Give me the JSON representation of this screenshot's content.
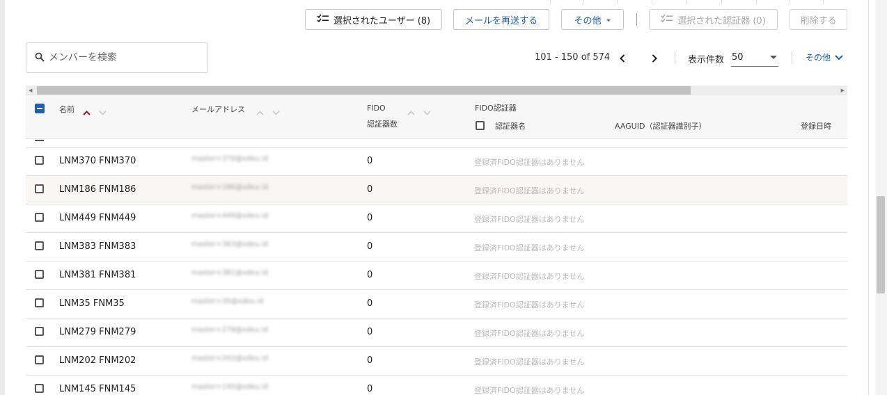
{
  "toolbar": {
    "selected_users_label": "選択されたユーザー (8)",
    "resend_mail_label": "メールを再送する",
    "others_label": "その他",
    "selected_authenticators_label": "選択された認証器 (0)",
    "delete_label": "削除する"
  },
  "search": {
    "placeholder": "メンバーを検索"
  },
  "pager": {
    "range": "101 - 150 of 574",
    "per_page_label": "表示件数",
    "per_page_value": "50",
    "more_label": "その他"
  },
  "table": {
    "columns": {
      "name": "名前",
      "email": "メールアドレス",
      "fido_line1": "FIDO",
      "fido_line2": "認証器数",
      "fido_auth_group": "FIDO認証器",
      "auth_name": "認証器名",
      "aaguid": "AAGUID（認証器識別子）",
      "registered_at": "登録日時"
    },
    "rows": [
      {
        "name": "LNM370 FNM370",
        "email": "master+370@xdeu.id",
        "fido_count": "0",
        "fido_status": "登録済FIDO認証器はありません",
        "highlight": false
      },
      {
        "name": "LNM186 FNM186",
        "email": "master+186@xdeu.id",
        "fido_count": "0",
        "fido_status": "登録済FIDO認証器はありません",
        "highlight": true
      },
      {
        "name": "LNM449 FNM449",
        "email": "master+449@xdeu.id",
        "fido_count": "0",
        "fido_status": "登録済FIDO認証器はありません",
        "highlight": false
      },
      {
        "name": "LNM383 FNM383",
        "email": "master+383@xdeu.id",
        "fido_count": "0",
        "fido_status": "登録済FIDO認証器はありません",
        "highlight": false
      },
      {
        "name": "LNM381 FNM381",
        "email": "master+381@xdeu.id",
        "fido_count": "0",
        "fido_status": "登録済FIDO認証器はありません",
        "highlight": false
      },
      {
        "name": "LNM35 FNM35",
        "email": "master+35@xdeu.id",
        "fido_count": "0",
        "fido_status": "登録済FIDO認証器はありません",
        "highlight": false
      },
      {
        "name": "LNM279 FNM279",
        "email": "master+279@xdeu.id",
        "fido_count": "0",
        "fido_status": "登録済FIDO認証器はありません",
        "highlight": false
      },
      {
        "name": "LNM202 FNM202",
        "email": "master+202@xdeu.id",
        "fido_count": "0",
        "fido_status": "登録済FIDO認証器はありません",
        "highlight": false
      },
      {
        "name": "LNM145 FNM145",
        "email": "master+145@xdeu.id",
        "fido_count": "0",
        "fido_status": "登録済FIDO認証器はありません",
        "highlight": false
      }
    ]
  },
  "colors": {
    "accent_blue": "#1a5fb4",
    "sort_active": "#8b1a1a",
    "header_bg": "#f7f7f7",
    "row_highlight": "#f8f7f4",
    "checkbox_checked": "#1a5fb4"
  },
  "icons": {
    "checklist": "checklist-icon",
    "search": "search-icon",
    "prev": "chevron-left-icon",
    "next": "chevron-right-icon",
    "dropdown": "caret-down-icon",
    "more": "chevron-down-icon",
    "sort_up": "chevron-up-icon",
    "sort_down": "chevron-down-icon"
  }
}
